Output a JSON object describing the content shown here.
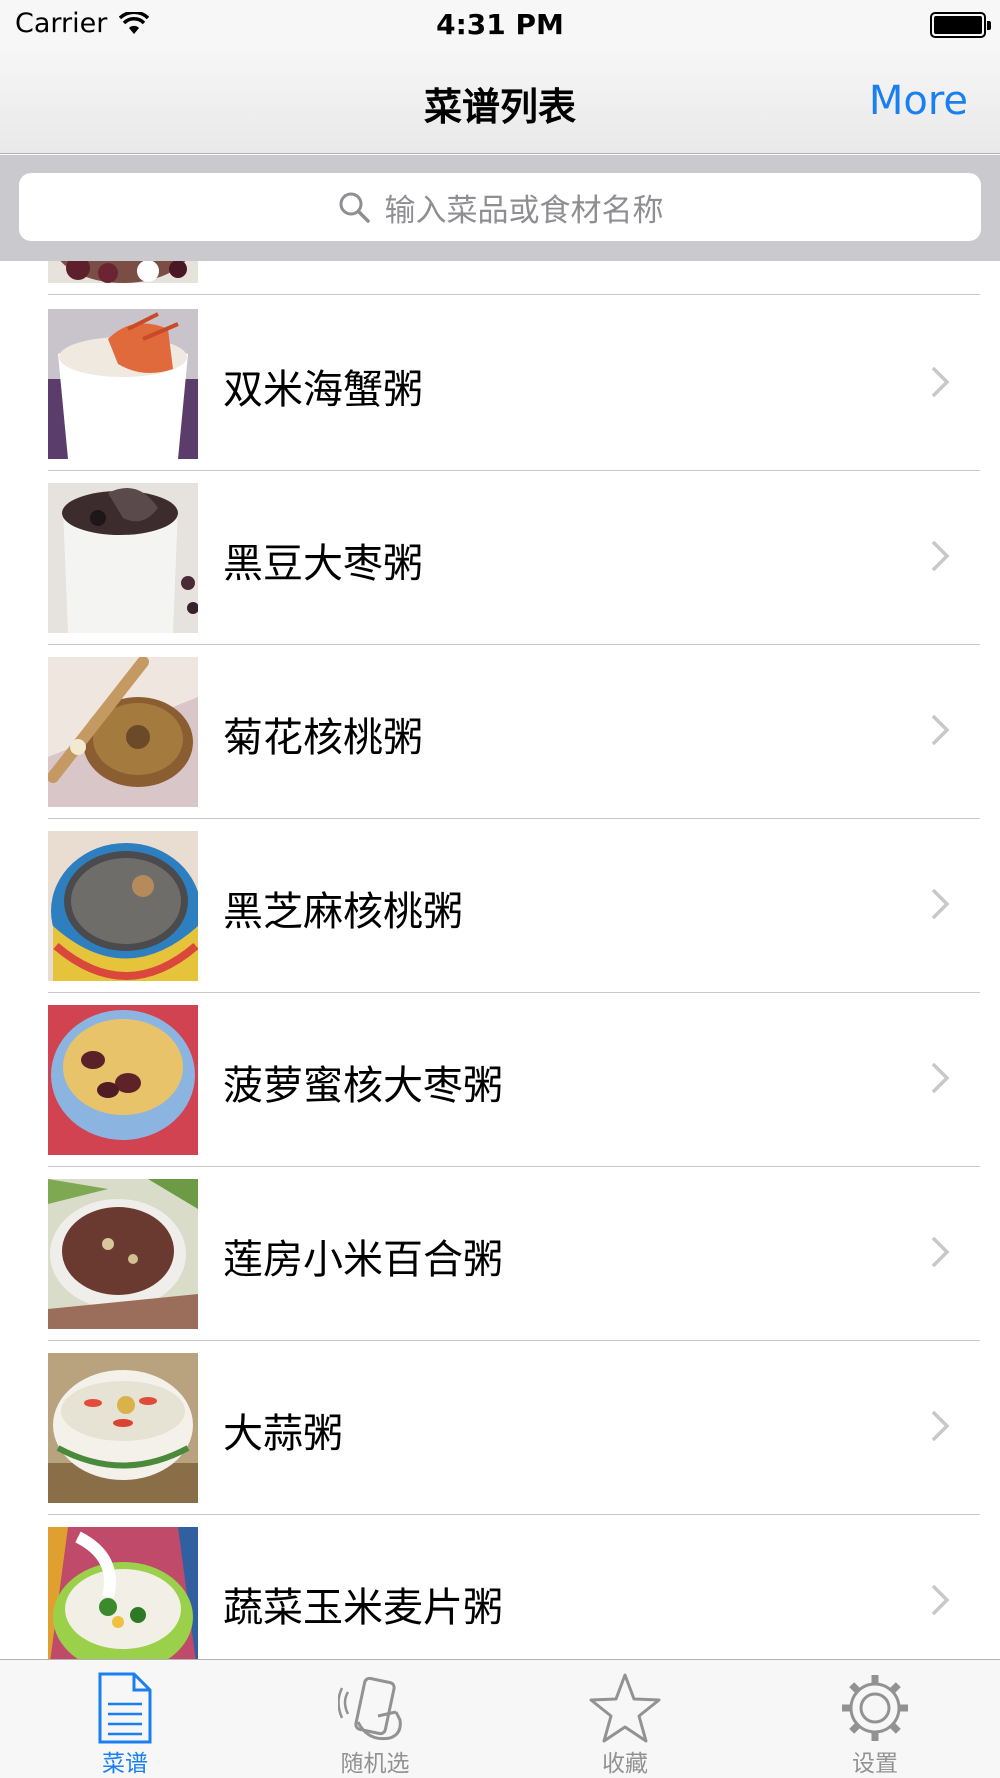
{
  "status_bar": {
    "carrier": "Carrier",
    "time": "4:31 PM"
  },
  "nav_bar": {
    "title": "菜谱列表",
    "more_label": "More"
  },
  "search": {
    "placeholder": "输入菜品或食材名称"
  },
  "recipes": [
    {
      "name": "双米海蟹粥"
    },
    {
      "name": "黑豆大枣粥"
    },
    {
      "name": "菊花核桃粥"
    },
    {
      "name": "黑芝麻核桃粥"
    },
    {
      "name": "菠萝蜜核大枣粥"
    },
    {
      "name": "莲房小米百合粥"
    },
    {
      "name": "大蒜粥"
    },
    {
      "name": "蔬菜玉米麦片粥"
    }
  ],
  "tab_bar": {
    "tabs": [
      {
        "label": "菜谱",
        "icon": "document-icon",
        "active": true
      },
      {
        "label": "随机选",
        "icon": "shake-phone-icon",
        "active": false
      },
      {
        "label": "收藏",
        "icon": "star-icon",
        "active": false
      },
      {
        "label": "设置",
        "icon": "gear-icon",
        "active": false
      }
    ]
  },
  "colors": {
    "accent": "#1a7ff0",
    "inactive_tab": "#929292",
    "separator": "#c8c7cc",
    "search_bg": "#c9c9ce"
  }
}
